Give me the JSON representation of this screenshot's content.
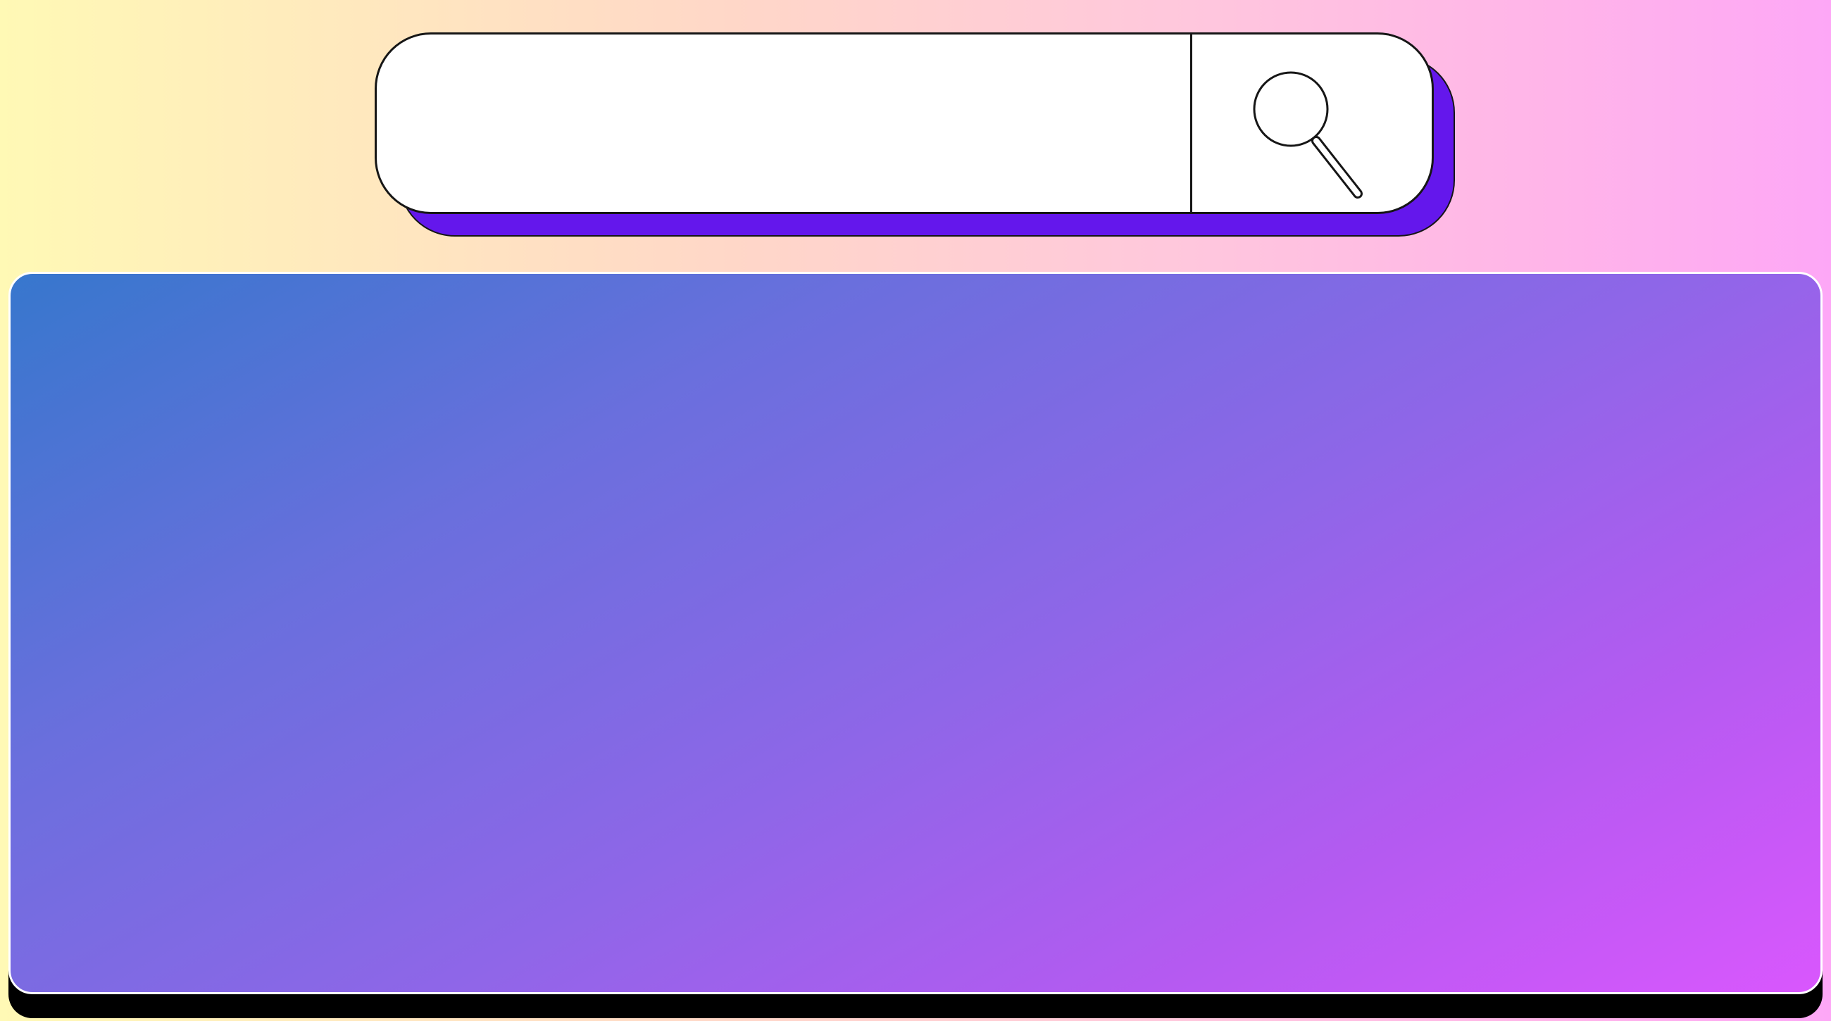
{
  "search": {
    "value": "",
    "placeholder": "",
    "button_icon": "search-icon",
    "colors": {
      "field": "#ffffff",
      "shadow": "#6417ec",
      "outline": "#161616"
    }
  },
  "panel": {
    "colors": {
      "gradient_start": "#3777cd",
      "gradient_end": "#d957fd",
      "border": "#ffffff",
      "shadow": "#000000"
    }
  },
  "page": {
    "background_colors": [
      "#fff9b5",
      "#ffc7dd",
      "#fda7f6"
    ]
  }
}
